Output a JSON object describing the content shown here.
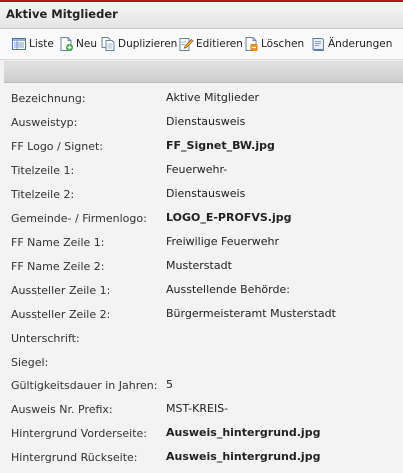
{
  "window": {
    "title": "Aktive Mitglieder",
    "accent_color": "#b5121b"
  },
  "toolbar": {
    "items": [
      {
        "label": "Liste",
        "icon": "list-icon"
      },
      {
        "label": "Neu",
        "icon": "new-document-icon"
      },
      {
        "label": "Duplizieren",
        "icon": "duplicate-icon"
      },
      {
        "label": "Editieren",
        "icon": "edit-icon"
      },
      {
        "label": "Löschen",
        "icon": "delete-icon"
      },
      {
        "label": "Änderungen",
        "icon": "history-book-icon"
      }
    ]
  },
  "fields": [
    {
      "label": "Bezeichnung:",
      "value": "Aktive Mitglieder",
      "bold": false
    },
    {
      "label": "Ausweistyp:",
      "value": "Dienstausweis",
      "bold": false
    },
    {
      "label": "FF Logo / Signet:",
      "value": "FF_Signet_BW.jpg",
      "bold": true
    },
    {
      "label": "Titelzeile 1:",
      "value": "Feuerwehr-",
      "bold": false
    },
    {
      "label": "Titelzeile 2:",
      "value": "Dienstausweis",
      "bold": false
    },
    {
      "label": "Gemeinde- / Firmenlogo:",
      "value": "LOGO_E-PROFVS.jpg",
      "bold": true
    },
    {
      "label": "FF Name Zeile 1:",
      "value": "Freiwilige Feuerwehr",
      "bold": false
    },
    {
      "label": "FF Name Zeile 2:",
      "value": "Musterstadt",
      "bold": false
    },
    {
      "label": "Aussteller Zeile 1:",
      "value": "Ausstellende Behörde:",
      "bold": false
    },
    {
      "label": "Aussteller Zeile 2:",
      "value": "Bürgermeisteramt Musterstadt",
      "bold": false
    },
    {
      "label": "Unterschrift:",
      "value": "",
      "bold": false
    },
    {
      "label": "Siegel:",
      "value": "",
      "bold": false
    },
    {
      "label": "Gültigkeitsdauer in Jahren:",
      "value": "5",
      "bold": false
    },
    {
      "label": "Ausweis Nr. Prefix:",
      "value": "MST-KREIS-",
      "bold": false
    },
    {
      "label": "Hintergrund Vorderseite:",
      "value": "Ausweis_hintergrund.jpg",
      "bold": true
    },
    {
      "label": "Hintergrund Rückseite:",
      "value": "Ausweis_hintergrund.jpg",
      "bold": true
    }
  ]
}
